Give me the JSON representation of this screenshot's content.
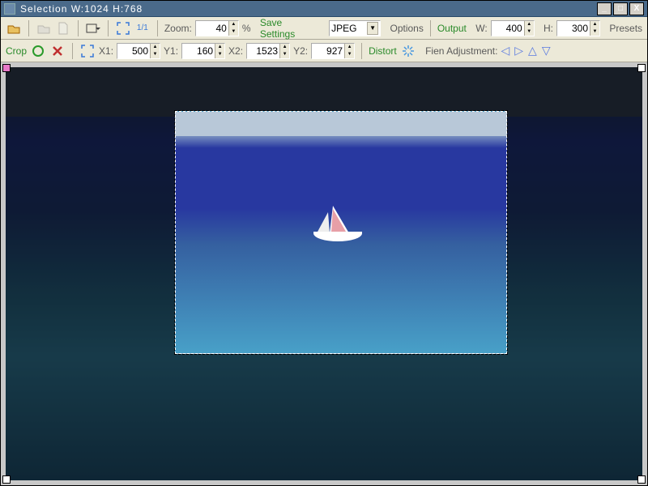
{
  "title": "Selection  W:1024 H:768",
  "toolbar": {
    "zoom_label": "Zoom:",
    "zoom_value": "40",
    "zoom_pct": "%",
    "save_settings": "Save Settings",
    "format": "JPEG",
    "options": "Options",
    "output": "Output",
    "w_label": "W:",
    "w_value": "400",
    "h_label": "H:",
    "h_value": "300",
    "presets": "Presets"
  },
  "cropbar": {
    "crop": "Crop",
    "x1_label": "X1:",
    "x1": "500",
    "y1_label": "Y1:",
    "y1": "160",
    "x2_label": "X2:",
    "x2": "1523",
    "y2_label": "Y2:",
    "y2": "927",
    "distort": "Distort",
    "fien": "Fien Adjustment:"
  }
}
